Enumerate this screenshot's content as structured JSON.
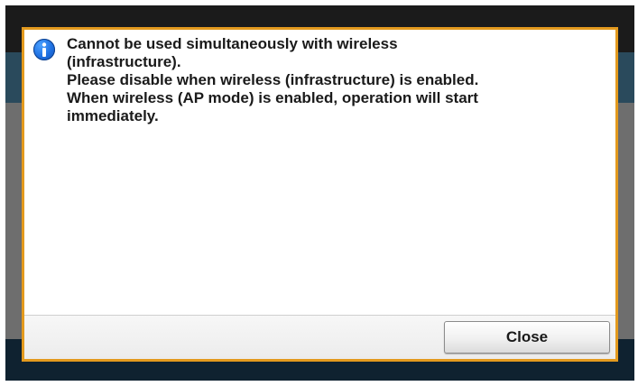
{
  "dialog": {
    "icon": "info-icon",
    "message": "Cannot be used simultaneously with wireless\n(infrastructure).\nPlease disable when wireless (infrastructure) is enabled.\nWhen wireless (AP mode) is enabled, operation will start\nimmediately.",
    "close_label": "Close"
  },
  "colors": {
    "dialog_border": "#e39a1e",
    "info_icon": "#1e6fe0",
    "header_band": "#2a4a5c",
    "background_dim": "#6e6e6e"
  }
}
